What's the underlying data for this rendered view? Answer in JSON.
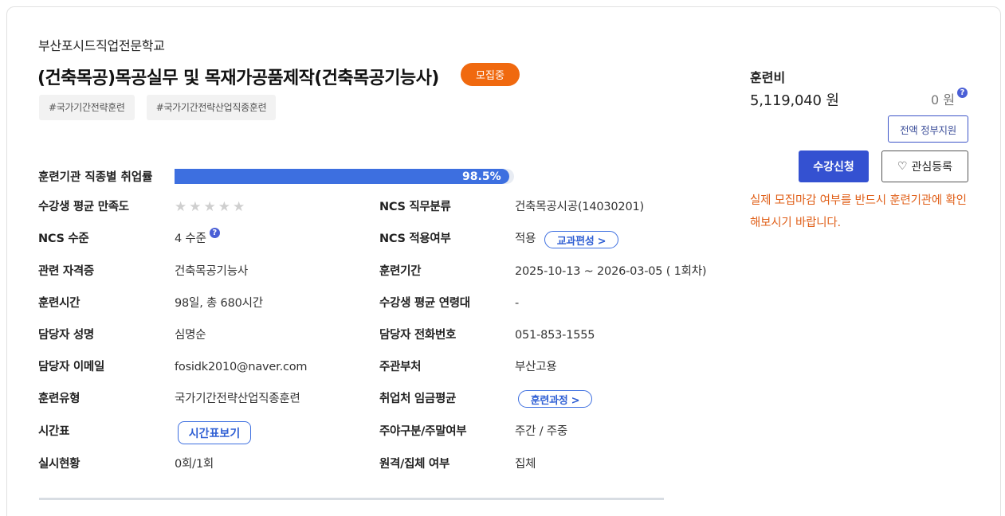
{
  "institution": "부산포시드직업전문학교",
  "course": {
    "title": "(건축목공)목공실무 및 목재가공품제작(건축목공기능사)",
    "status": "모집중",
    "tags": [
      "#국가기간전략훈련",
      "#국가기간전략산업직종훈련"
    ]
  },
  "employment_rate": {
    "label": "훈련기관 직종별 취업률",
    "value": "98.5%",
    "percent": 98.5
  },
  "info": {
    "satisfaction_label": "수강생 평균 만족도",
    "satisfaction_stars": 0,
    "ncs_category_label": "NCS 직무분류",
    "ncs_category_value": "건축목공시공(14030201)",
    "ncs_level_label": "NCS 수준",
    "ncs_level_value": "4 수준",
    "ncs_apply_label": "NCS 적용여부",
    "ncs_apply_value": "적용",
    "curriculum_btn": "교과편성 >",
    "cert_label": "관련 자격증",
    "cert_value": "건축목공기능사",
    "period_label": "훈련기간",
    "period_value": "2025-10-13 ~ 2026-03-05 ( 1회차)",
    "hours_label": "훈련시간",
    "hours_value": "98일, 총 680시간",
    "age_label": "수강생 평균 연령대",
    "age_value": "-",
    "manager_label": "담당자 성명",
    "manager_value": "심명순",
    "phone_label": "담당자 전화번호",
    "phone_value": "051-853-1555",
    "email_label": "담당자 이메일",
    "email_value": "fosidk2010@naver.com",
    "agency_label": "주관부처",
    "agency_value": "부산고용",
    "type_label": "훈련유형",
    "type_value": "국가기간전략산업직종훈련",
    "wage_label": "취업처 임금평균",
    "course_btn": "훈련과정 >",
    "timetable_label": "시간표",
    "timetable_btn": "시간표보기",
    "schedule_label": "주야구분/주말여부",
    "schedule_value": "주간 / 주중",
    "status_label": "실시현황",
    "status_value": "0회/1회",
    "remote_label": "원격/집체 여부",
    "remote_value": "집체"
  },
  "fee": {
    "label": "훈련비",
    "amount": "5,119,040 원",
    "support": "0 원",
    "gov_btn": "전액 정부지원"
  },
  "actions": {
    "apply": "수강신청",
    "favorite": "관심등록"
  },
  "notice": "실제 모집마감 여부를 반드시 훈련기관에 확인해보시기 바랍니다.",
  "colors": {
    "accent": "#3451d1",
    "status": "#f0690f",
    "notice": "#e0601a"
  }
}
